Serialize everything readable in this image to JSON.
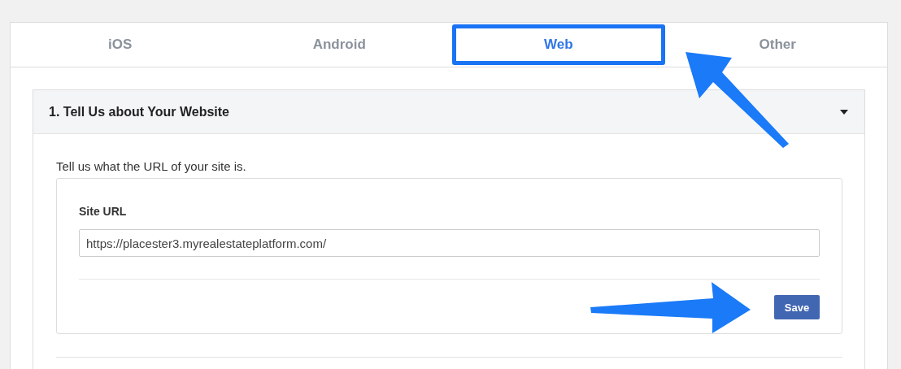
{
  "tabs": [
    {
      "label": "iOS",
      "selected": false,
      "highlighted": false
    },
    {
      "label": "Android",
      "selected": false,
      "highlighted": false
    },
    {
      "label": "Web",
      "selected": true,
      "highlighted": true
    },
    {
      "label": "Other",
      "selected": false,
      "highlighted": false
    }
  ],
  "section": {
    "title": "1. Tell Us about Your Website",
    "expanded": true,
    "description": "Tell us what the URL of your site is.",
    "field": {
      "label": "Site URL",
      "value": "https://placester3.myrealestateplatform.com/"
    },
    "save_button": "Save"
  },
  "annotations": [
    {
      "kind": "arrow"
    },
    {
      "kind": "arrow"
    }
  ]
}
